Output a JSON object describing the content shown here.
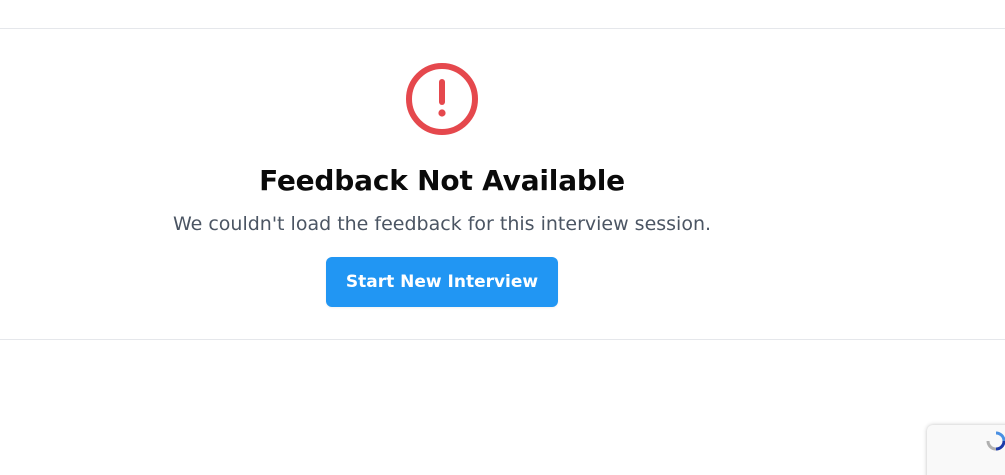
{
  "error": {
    "title": "Feedback Not Available",
    "message": "We couldn't load the feedback for this interview session.",
    "icon": "alert-circle-icon",
    "icon_color": "#e5484d"
  },
  "actions": {
    "start_new_interview_label": "Start New Interview",
    "button_color": "#2196f3"
  },
  "recaptcha_badge": {
    "icon": "recaptcha-icon"
  }
}
